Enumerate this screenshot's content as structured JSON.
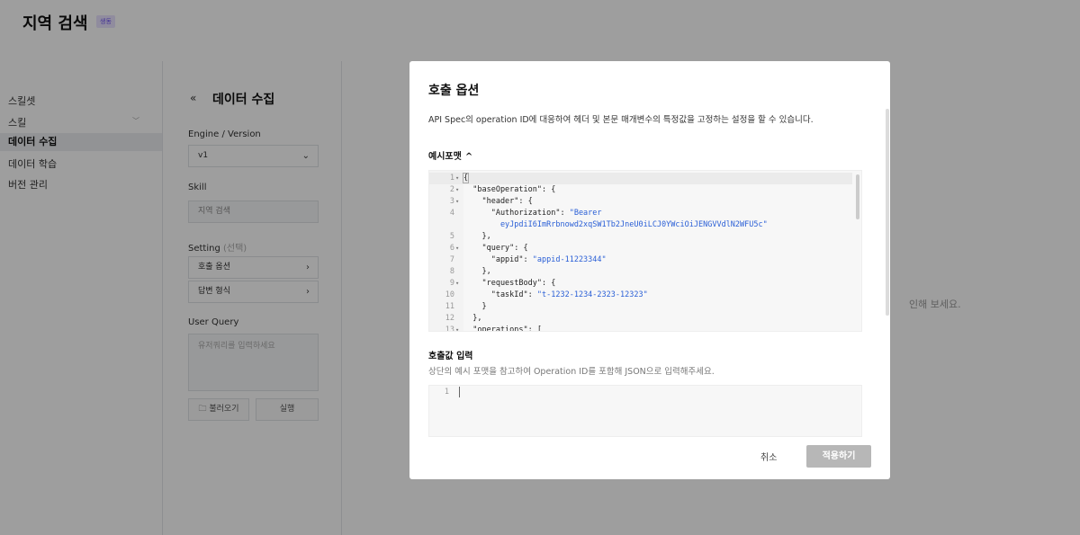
{
  "page": {
    "title": "지역 검색",
    "badge": "생동"
  },
  "sidebar": {
    "items": [
      "스킬셋",
      "스킬",
      "데이터 수집",
      "데이터 학습",
      "버전 관리"
    ]
  },
  "panel": {
    "title": "데이터 수집",
    "engine_label": "Engine / Version",
    "engine_value": "v1",
    "skill_label": "Skill",
    "skill_value": "지역 검색",
    "setting_label": "Setting",
    "setting_optional": "(선택)",
    "setting_items": [
      "호출 옵션",
      "답변 형식"
    ],
    "query_label": "User Query",
    "query_placeholder": "유저쿼리를 입력하세요",
    "load_button": "불러오기",
    "run_button": "실행"
  },
  "background_hint": "인해 보세요.",
  "modal": {
    "title": "호출 옵션",
    "description": "API Spec의 operation ID에 대응하여 헤더 및 본문 매개변수의 특정값을 고정하는 설정을 할 수 있습니다.",
    "example_title": "예시포맷",
    "example_lines": [
      {
        "n": "1",
        "fold": true,
        "text": "{"
      },
      {
        "n": "2",
        "fold": true,
        "text": "  \"baseOperation\": {"
      },
      {
        "n": "3",
        "fold": true,
        "text": "    \"header\": {"
      },
      {
        "n": "4",
        "fold": false,
        "key": "      \"Authorization\": ",
        "str": "\"Bearer"
      },
      {
        "n": "",
        "fold": false,
        "str": "        eyJpdiI6ImRrbnowd2xqSW1Tb2JneU0iLCJ0YWciOiJENGVVdlN2WFU5c\""
      },
      {
        "n": "5",
        "fold": false,
        "text": "    },"
      },
      {
        "n": "6",
        "fold": true,
        "text": "    \"query\": {"
      },
      {
        "n": "7",
        "fold": false,
        "key": "      \"appid\": ",
        "str": "\"appid-11223344\""
      },
      {
        "n": "8",
        "fold": false,
        "text": "    },"
      },
      {
        "n": "9",
        "fold": true,
        "text": "    \"requestBody\": {"
      },
      {
        "n": "10",
        "fold": false,
        "key": "      \"taskId\": ",
        "str": "\"t-1232-1234-2323-12323\""
      },
      {
        "n": "11",
        "fold": false,
        "text": "    }"
      },
      {
        "n": "12",
        "fold": false,
        "text": "  },"
      },
      {
        "n": "13",
        "fold": true,
        "text": "  \"operations\": ["
      }
    ],
    "input_title": "호출값 입력",
    "input_desc": "상단의 예시 포맷을 참고하여 Operation ID를 포함해 JSON으로 입력해주세요.",
    "input_line": "1",
    "cancel": "취소",
    "apply": "적용하기"
  },
  "colors": {
    "string": "#2a5fd6",
    "apply_disabled": "#b7b7b7",
    "overlay": "rgba(0,0,0,0.38)"
  }
}
